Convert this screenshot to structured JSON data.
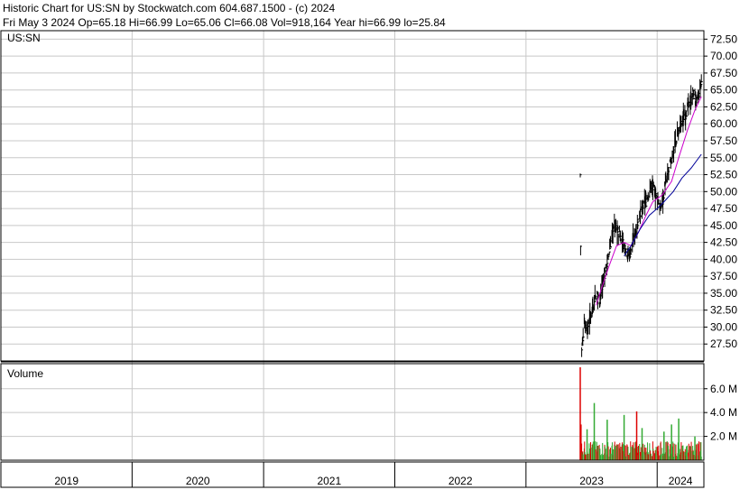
{
  "header": {
    "line1": "Historic Chart for US:SN by Stockwatch.com 604.687.1500 - (c) 2024",
    "line2": "Fri May  3 2024   Op=65.18  Hi=66.99  Lo=65.06  Cl=66.08  Vol=918,164  Year hi=66.99  lo=25.84"
  },
  "colors": {
    "price_bar": "#000000",
    "ma_short": "#cc00cc",
    "ma_long": "#000099",
    "volume_up": "#33aa33",
    "volume_down": "#dd0000",
    "grid": "#c8c8c8",
    "axis": "#000000"
  },
  "chart_data": [
    {
      "type": "ohlc",
      "panel_label": "US:SN",
      "y_axis": {
        "ticks": [
          "72.50",
          "70.00",
          "67.50",
          "65.00",
          "62.50",
          "60.00",
          "57.50",
          "55.00",
          "52.50",
          "50.00",
          "47.50",
          "45.00",
          "42.50",
          "40.00",
          "37.50",
          "35.00",
          "32.50",
          "30.00",
          "27.50"
        ],
        "ylim": [
          25.0,
          73.75
        ]
      },
      "x_axis": {
        "years": [
          "2019",
          "2020",
          "2021",
          "2022",
          "2023",
          "2024"
        ],
        "range": [
          "2019-01-01",
          "2024-05-10"
        ]
      },
      "grid": true,
      "close_path": [
        [
          "2023-06-01",
          52.5
        ],
        [
          "2023-06-02",
          42.0
        ],
        [
          "2023-06-05",
          26.5
        ],
        [
          "2023-06-12",
          31.0
        ],
        [
          "2023-06-20",
          29.5
        ],
        [
          "2023-07-05",
          33.0
        ],
        [
          "2023-07-15",
          35.0
        ],
        [
          "2023-07-25",
          34.0
        ],
        [
          "2023-08-05",
          37.0
        ],
        [
          "2023-08-20",
          41.0
        ],
        [
          "2023-09-01",
          45.0
        ],
        [
          "2023-09-15",
          44.0
        ],
        [
          "2023-10-01",
          42.0
        ],
        [
          "2023-10-15",
          40.5
        ],
        [
          "2023-11-01",
          44.0
        ],
        [
          "2023-11-15",
          47.0
        ],
        [
          "2023-12-01",
          48.5
        ],
        [
          "2023-12-15",
          51.0
        ],
        [
          "2024-01-01",
          49.0
        ],
        [
          "2024-01-10",
          47.5
        ],
        [
          "2024-01-20",
          50.0
        ],
        [
          "2024-02-01",
          53.0
        ],
        [
          "2024-02-15",
          56.0
        ],
        [
          "2024-03-01",
          59.0
        ],
        [
          "2024-03-15",
          61.0
        ],
        [
          "2024-04-01",
          63.0
        ],
        [
          "2024-04-10",
          64.5
        ],
        [
          "2024-04-20",
          63.0
        ],
        [
          "2024-05-03",
          66.08
        ]
      ],
      "series": [
        {
          "color_key": "ma_short",
          "points": [
            [
              "2023-07-15",
              33.2
            ],
            [
              "2023-08-01",
              36.0
            ],
            [
              "2023-08-20",
              39.0
            ],
            [
              "2023-09-10",
              42.0
            ],
            [
              "2023-10-01",
              42.5
            ],
            [
              "2023-10-20",
              42.0
            ],
            [
              "2023-11-10",
              44.0
            ],
            [
              "2023-12-01",
              46.5
            ],
            [
              "2023-12-20",
              48.5
            ],
            [
              "2024-01-15",
              49.5
            ],
            [
              "2024-02-10",
              51.5
            ],
            [
              "2024-03-01",
              55.0
            ],
            [
              "2024-03-25",
              59.0
            ],
            [
              "2024-04-15",
              62.0
            ],
            [
              "2024-05-03",
              64.0
            ]
          ]
        },
        {
          "color_key": "ma_long",
          "points": [
            [
              "2023-10-01",
              40.5
            ],
            [
              "2023-10-20",
              42.0
            ],
            [
              "2023-11-15",
              44.5
            ],
            [
              "2023-12-10",
              46.5
            ],
            [
              "2024-01-01",
              47.5
            ],
            [
              "2024-01-20",
              48.5
            ],
            [
              "2024-02-15",
              50.0
            ],
            [
              "2024-03-10",
              52.0
            ],
            [
              "2024-04-05",
              53.5
            ],
            [
              "2024-05-03",
              55.5
            ]
          ]
        }
      ]
    },
    {
      "type": "bar",
      "panel_label": "Volume",
      "y_axis": {
        "ticks": [
          "6.0 M",
          "4.0 M",
          "2.0 M"
        ],
        "ylim": [
          0,
          7.8
        ]
      },
      "spikes": [
        [
          "2023-06-01",
          7.8,
          "down"
        ],
        [
          "2023-06-03",
          3.0,
          "down"
        ],
        [
          "2023-06-20",
          2.6,
          "up"
        ],
        [
          "2023-07-10",
          4.8,
          "up"
        ],
        [
          "2023-08-15",
          3.4,
          "up"
        ],
        [
          "2023-10-01",
          3.8,
          "up"
        ],
        [
          "2023-11-05",
          4.1,
          "down"
        ],
        [
          "2023-11-20",
          2.7,
          "up"
        ],
        [
          "2024-01-20",
          2.4,
          "up"
        ],
        [
          "2024-02-10",
          3.0,
          "up"
        ],
        [
          "2024-03-01",
          3.5,
          "up"
        ],
        [
          "2024-04-15",
          2.0,
          "up"
        ]
      ]
    }
  ]
}
